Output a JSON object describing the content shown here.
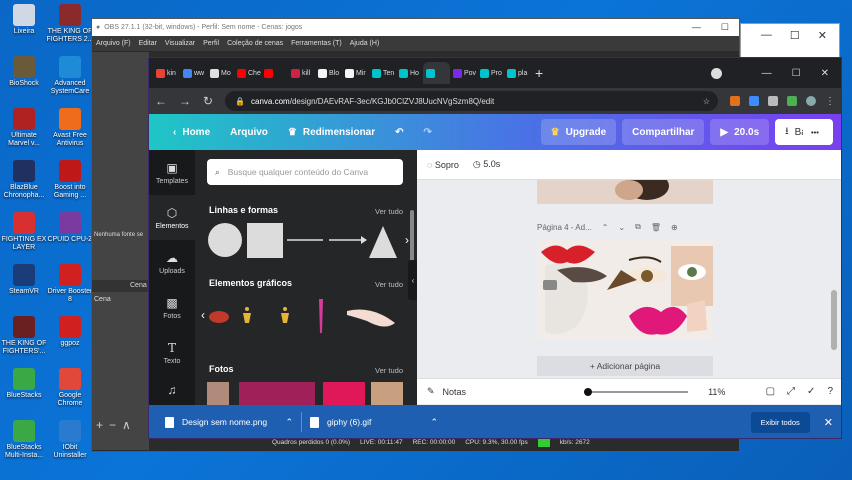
{
  "desktop": {
    "icons": [
      {
        "label": "Lixeira",
        "color": "#cfd8e4"
      },
      {
        "label": "THE KING OF FIGHTERS 2...",
        "color": "#8a2a2a"
      },
      {
        "label": "BioShock",
        "color": "#6a5a3a"
      },
      {
        "label": "Advanced SystemCare",
        "color": "#1f8ad6"
      },
      {
        "label": "Ultimate Marvel v...",
        "color": "#b02222"
      },
      {
        "label": "Avast Free Antivirus",
        "color": "#ef6c1c"
      },
      {
        "label": "BlazBlue Chronopha...",
        "color": "#203060"
      },
      {
        "label": "Boost into Gaming ...",
        "color": "#c01818"
      },
      {
        "label": "FIGHTING EX LAYER",
        "color": "#d83030"
      },
      {
        "label": "CPUID CPU-Z",
        "color": "#7a3aa0"
      },
      {
        "label": "SteamVR",
        "color": "#1a3d7a"
      },
      {
        "label": "Driver Booster 8",
        "color": "#d02020"
      },
      {
        "label": "THE KING OF FIGHTERS'...",
        "color": "#6a2020"
      },
      {
        "label": "ggpoz",
        "color": "#d02020"
      },
      {
        "label": "BlueStacks",
        "color": "#3aa845"
      },
      {
        "label": "Google Chrome",
        "color": "#e2483a"
      },
      {
        "label": "BlueStacks Multi-Insta...",
        "color": "#3aa845"
      },
      {
        "label": "IObit Uninstaller",
        "color": "#2a7acf"
      }
    ]
  },
  "obs": {
    "title": "OBS 27.1.1 (32-bit, windows) - Perfil: Sem nome - Cenas: jogos",
    "menu": [
      "Arquivo (F)",
      "Editar",
      "Visualizar",
      "Perfil",
      "Coleção de cenas",
      "Ferramentas (T)",
      "Ajuda (H)"
    ],
    "no_source": "Nenhuma fonte se",
    "scenes_header": "Cena",
    "scene": "Cena",
    "status": {
      "dropped": "Quadros perdidos 0 (0.0%)",
      "live": "LIVE: 00:11:47",
      "rec": "REC: 00:00:00",
      "cpu": "CPU: 9.3%, 30.00 fps",
      "kbs": "kb/s: 2672"
    }
  },
  "browser": {
    "tabs": [
      {
        "label": "kin",
        "color": "#ea4335"
      },
      {
        "label": "ww",
        "color": "#4285f4"
      },
      {
        "label": "Mo",
        "color": "#e0e0e0"
      },
      {
        "label": "Che",
        "color": "#ff0000"
      },
      {
        "label": "",
        "color": "#ff0000"
      },
      {
        "label": "kill",
        "color": "#cc2244"
      },
      {
        "label": "Blo",
        "color": "#f5f5f5"
      },
      {
        "label": "Mir",
        "color": "#f5f5f5"
      },
      {
        "label": "Ten",
        "color": "#00c4cc"
      },
      {
        "label": "Ho",
        "color": "#00c4cc"
      },
      {
        "label": "",
        "color": "#00c4cc"
      },
      {
        "label": "Pov",
        "color": "#7d2ae8"
      },
      {
        "label": "Pro",
        "color": "#00c4cc"
      },
      {
        "label": "pla",
        "color": "#00c4cc"
      }
    ],
    "url_host": "canva.com",
    "url_path": "/design/DAEvRAF-3ec/KGJb0ClZVJ8UucNVgSzm8Q/edit"
  },
  "canva": {
    "home": "Home",
    "file": "Arquivo",
    "resize": "Redimensionar",
    "upgrade": "Upgrade",
    "share": "Compartilhar",
    "duration": "20.0s",
    "download": "Baixar",
    "rail": [
      "Templates",
      "Elementos",
      "Uploads",
      "Fotos",
      "Texto"
    ],
    "search_placeholder": "Busque qualquer conteúdo do Canva",
    "lines_title": "Linhas e formas",
    "graphics_title": "Elementos gráficos",
    "photos_title": "Fotos",
    "see_all": "Ver tudo",
    "effect": "Sopro",
    "time": "5.0s",
    "page_label": "Página 4 - Ad...",
    "add_page": "+ Adicionar página",
    "notes": "Notas",
    "zoom": "11%"
  },
  "downloads": {
    "items": [
      "Design sem nome.png",
      "giphy (6).gif"
    ],
    "show_all": "Exibir todos"
  }
}
